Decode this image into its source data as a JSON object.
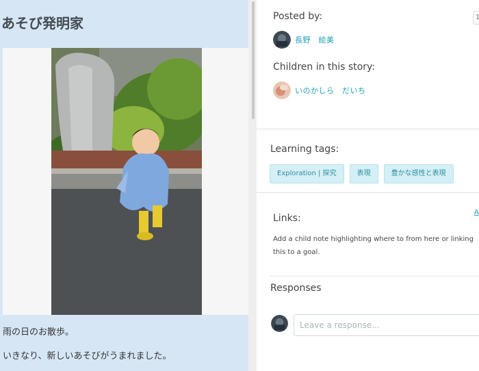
{
  "story": {
    "title": "あそび発明家",
    "photo_alt": "雨の日のお散歩の写真",
    "lines": [
      "雨の日のお散歩。",
      "いきなり、新しいあそびがうまれました。"
    ]
  },
  "sidebar": {
    "counter": "1",
    "posted_by_label": "Posted by:",
    "author_name": "長野　絵美",
    "children_label": "Children in this story:",
    "child_name": "いのかしら　だいち",
    "learning_tags_label": "Learning tags:",
    "tags": [
      {
        "label": "Exploration | 探究"
      },
      {
        "label": "表現"
      },
      {
        "label": "豊かな感性と表現"
      }
    ],
    "links_label": "Links:",
    "add_link_label": "A",
    "links_help": "Add a child note highlighting where to from here or linking this to a goal.",
    "responses_label": "Responses",
    "response_placeholder": "Leave a response..."
  },
  "colors": {
    "left_pane_bg": "#d6e6f5",
    "accent_link": "#1b9fb5",
    "tag_bg": "#d5eff6"
  }
}
